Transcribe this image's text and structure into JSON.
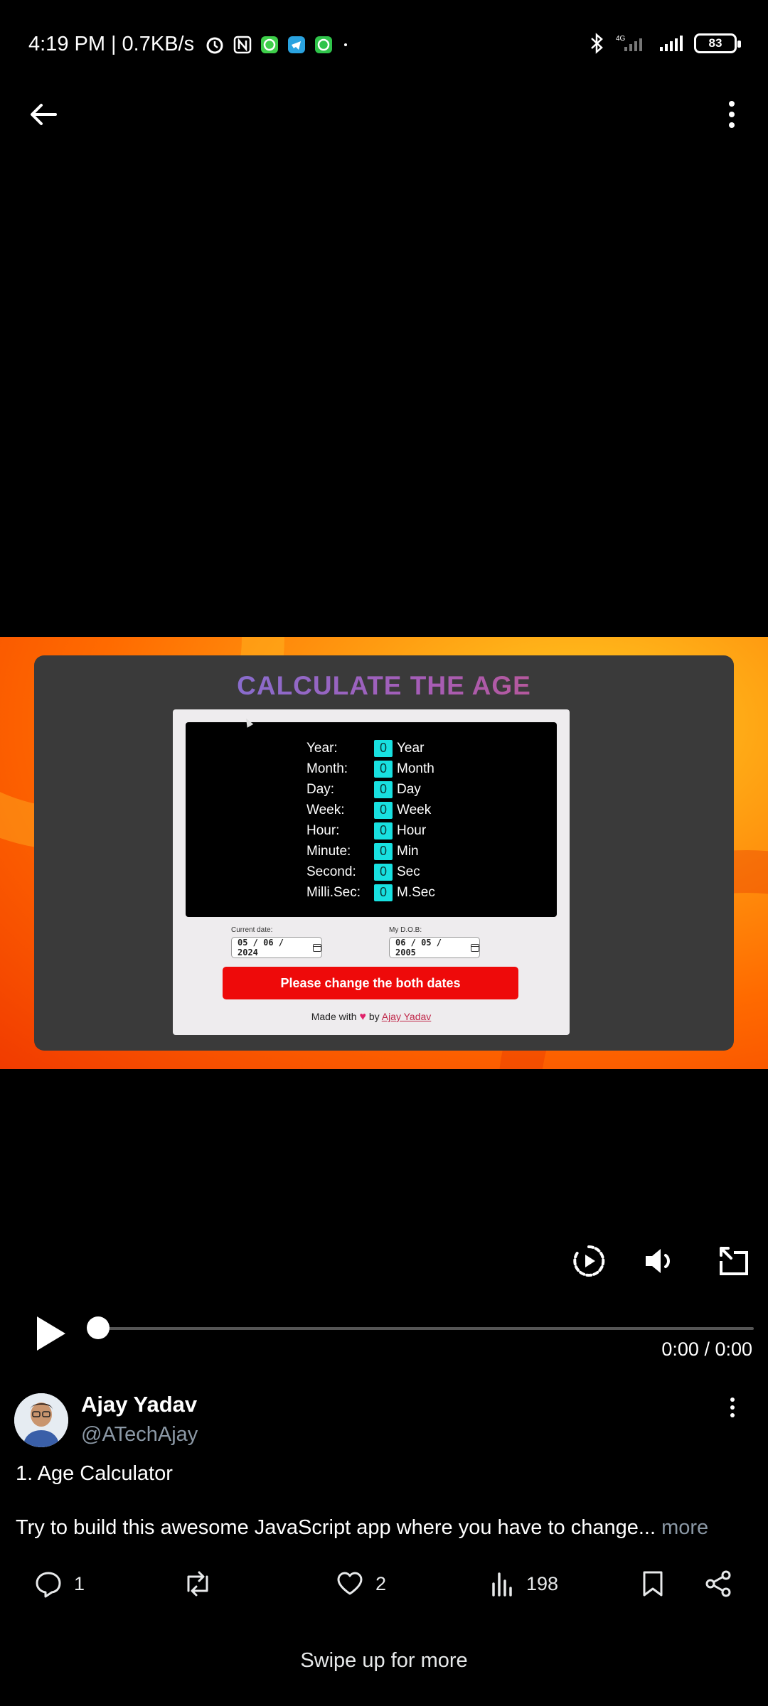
{
  "status_bar": {
    "time": "4:19 PM",
    "separator": "|",
    "speed": "0.7KB/s",
    "network": "4G",
    "battery": "83"
  },
  "video": {
    "app": {
      "title": "CALCULATE THE AGE",
      "rows": [
        {
          "label": "Year:",
          "value": "0",
          "unit": "Year"
        },
        {
          "label": "Month:",
          "value": "0",
          "unit": "Month"
        },
        {
          "label": "Day:",
          "value": "0",
          "unit": "Day"
        },
        {
          "label": "Week:",
          "value": "0",
          "unit": "Week"
        },
        {
          "label": "Hour:",
          "value": "0",
          "unit": "Hour"
        },
        {
          "label": "Minute:",
          "value": "0",
          "unit": "Min"
        },
        {
          "label": "Second:",
          "value": "0",
          "unit": "Sec"
        },
        {
          "label": "Milli.Sec:",
          "value": "0",
          "unit": "M.Sec"
        }
      ],
      "current_date_label": "Current date:",
      "current_date": "05 / 06 / 2024",
      "dob_label": "My D.O.B:",
      "dob": "06 / 05 / 2005",
      "button": "Please change the both dates",
      "made_with_prefix": "Made with",
      "heart": "♥",
      "made_with_by": "by",
      "made_with_author": "Ajay Yadav"
    },
    "time": "0:00 / 0:00",
    "progress": 0
  },
  "post": {
    "author_name": "Ajay Yadav",
    "author_handle": "@ATechAjay",
    "title": "1. Age Calculator",
    "body": "Try to build this awesome JavaScript app where you have to change...",
    "more": "more"
  },
  "actions": {
    "replies": "1",
    "likes": "2",
    "views": "198"
  },
  "footer": {
    "swipe_hint": "Swipe up for more"
  },
  "icons": [
    "back-arrow-icon",
    "more-vertical-icon",
    "play-icon",
    "playback-speed-icon",
    "volume-icon",
    "rotate-screen-icon",
    "reply-icon",
    "retweet-icon",
    "like-icon",
    "views-icon",
    "bookmark-icon",
    "share-icon"
  ]
}
